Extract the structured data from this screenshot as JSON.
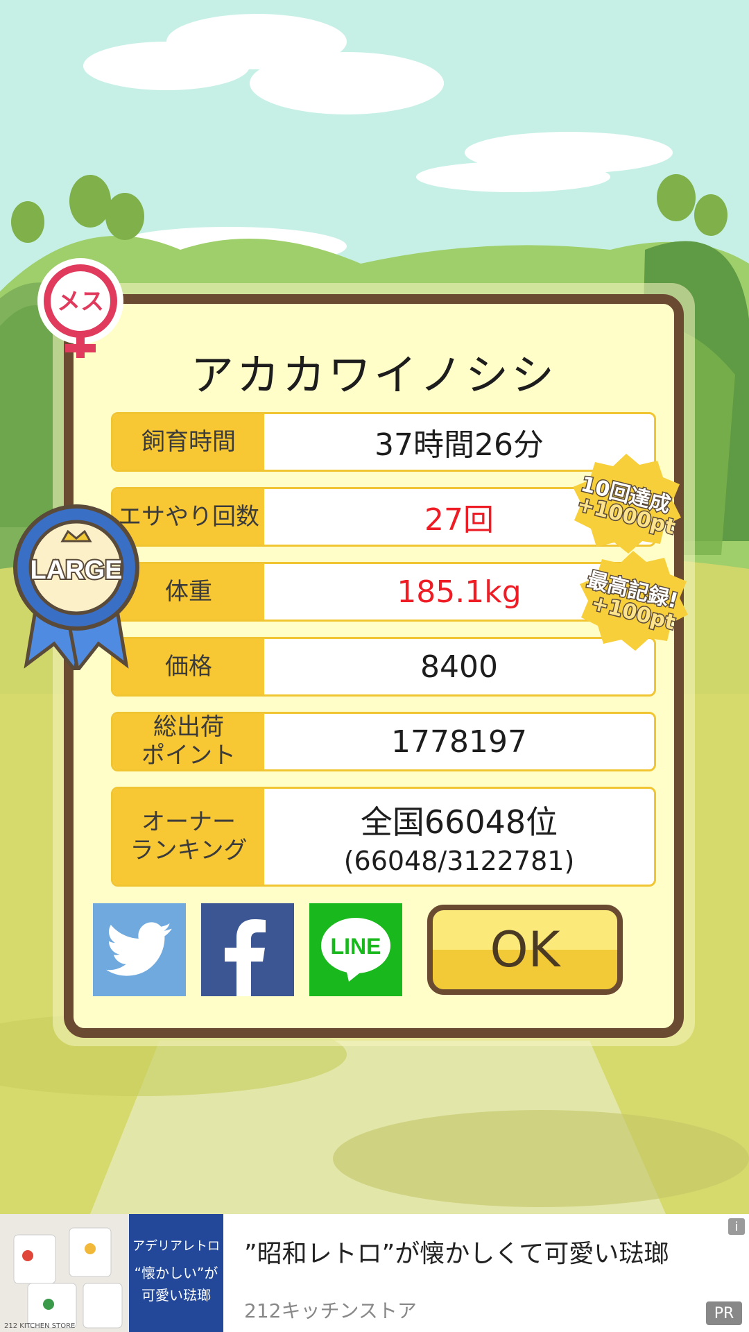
{
  "animal": {
    "name": "アカカワイノシシ",
    "gender_label": "メス",
    "size_label": "LARGE"
  },
  "stats": [
    {
      "label": "飼育時間",
      "value": "37時間26分",
      "highlight": false
    },
    {
      "label": "エサやり回数",
      "value": "27回",
      "highlight": true
    },
    {
      "label": "体重",
      "value": "185.1kg",
      "highlight": true
    },
    {
      "label": "価格",
      "value": "8400",
      "highlight": false
    },
    {
      "label": "総出荷\nポイント",
      "value": "1778197",
      "highlight": false
    },
    {
      "label": "オーナー\nランキング",
      "value": "全国66048位",
      "sub_value": "(66048/3122781)",
      "highlight": false
    }
  ],
  "awards": [
    {
      "line1": "10回達成",
      "line2": "+1000pt"
    },
    {
      "line1": "最高記録!",
      "line2": "+100pt"
    }
  ],
  "buttons": {
    "twitter": "twitter-icon",
    "facebook": "facebook-icon",
    "line": "LINE",
    "ok": "OK"
  },
  "ad": {
    "title": "”昭和レトロ”が懐かしくて可愛い琺瑯",
    "source": "212キッチンストア",
    "pr": "PR",
    "info": "i",
    "image_text1": "アデリアレトロ",
    "image_text2": "“懐かしい”が",
    "image_text3": "可愛い琺瑯",
    "image_brand": "212 KITCHEN STORE"
  },
  "colors": {
    "frame": "#6b4a32",
    "label_bg": "#f7c734",
    "highlight": "#ee1c24"
  }
}
